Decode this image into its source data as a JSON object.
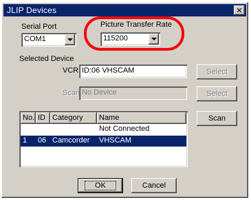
{
  "window": {
    "title": "JLIP Devices",
    "close_glyph": "✕"
  },
  "serial_port": {
    "label": "Serial Port",
    "value": "COM1"
  },
  "picture_rate": {
    "label": "Picture Transfer Rate",
    "value": "115200"
  },
  "selected_device": {
    "group_label": "Selected Device",
    "vcr": {
      "label": "VCR",
      "value": "ID:06 VHSCAM",
      "button": "Select"
    },
    "scan": {
      "label": "Scan",
      "value": "No Device",
      "button": "Select"
    }
  },
  "device_list": {
    "columns": [
      "No.",
      "ID",
      "Category",
      "Name"
    ],
    "rows": [
      {
        "no": "",
        "id": "",
        "category": "",
        "name": "Not Connected",
        "selected": false
      },
      {
        "no": "1",
        "id": "06",
        "category": "Camcorder",
        "name": "VHSCAM",
        "selected": true
      }
    ],
    "scan_button": "Scan"
  },
  "footer": {
    "ok": "OK",
    "cancel": "Cancel"
  },
  "colors": {
    "highlight": "#f00a0a",
    "title_bar": "#0a246a",
    "selection": "#0a246a"
  }
}
